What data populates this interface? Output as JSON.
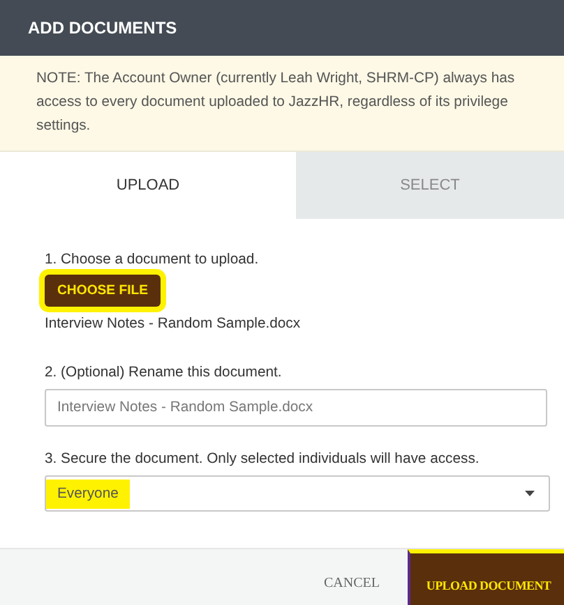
{
  "dialog": {
    "title": "ADD DOCUMENTS"
  },
  "note": "NOTE: The Account Owner (currently Leah Wright, SHRM-CP) always has access to every document uploaded to JazzHR, regardless of its privilege settings.",
  "tabs": [
    {
      "label": "UPLOAD",
      "selected": true
    },
    {
      "label": "SELECT",
      "selected": false
    }
  ],
  "step_1": {
    "label": "1. Choose a document to upload.",
    "button": "CHOOSE FILE",
    "highlighted": true,
    "file_name": "Interview Notes - Random Sample.docx"
  },
  "step_2": {
    "label": "2. (Optional) Rename this document.",
    "placeholder": "Interview Notes - Random Sample.docx"
  },
  "step_3": {
    "label": "3. Secure the document. Only selected individuals will have access.",
    "value": "Everyone",
    "highlighted": true
  },
  "footer": {
    "cancel": "CANCEL",
    "submit": "UPLOAD DOCUMENT",
    "submit_highlighted": true
  }
}
